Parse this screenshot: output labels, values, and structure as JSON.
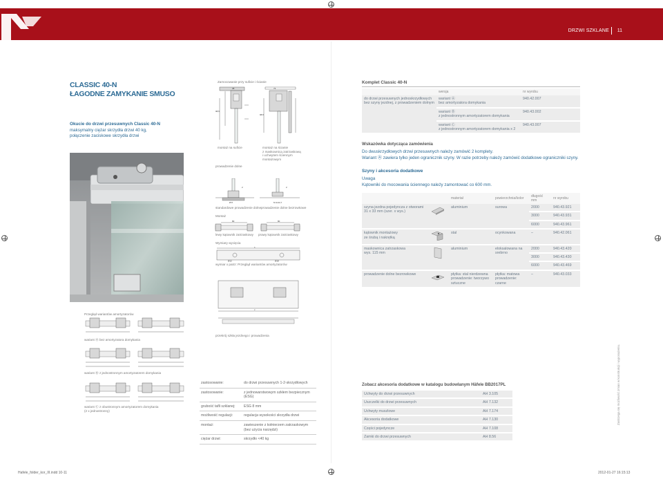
{
  "header": {
    "section_label": "DRZWI SZKLANE",
    "page_number": "11",
    "accent_color": "#a8101a"
  },
  "intro": {
    "title_line1": "CLASSIC 40-N",
    "title_line2": "ŁAGODNE ZAMYKANIE SMUSO",
    "subtitle": "Okucie do drzwi przesuwnych Classic 40-N",
    "desc_line1": "maksymalny ciężar skrzydła drzwi 40 kg,",
    "desc_line2": "połączenie zaciskowe skrzydła drzwi"
  },
  "drawings": {
    "mounting_title": "Zamocowanie przy suficie i ścianie",
    "ceiling_caption": "montaż na suficie",
    "wall_caption": "montaż na ścianie\nz maskownicą zatrzaskową\ni uchwytem ściennym\nmontażowym",
    "floor_guide_title": "prowadzenie dolne",
    "std_guide_caption": "standardowe prowadzenie dolne",
    "no_groove_caption": "prowadzenie dolne bezrowkowe",
    "assembly_title": "Montaż",
    "left_bracket_caption": "lewy kątownik zatrzaskowy",
    "right_bracket_caption": "prawy kątownik zatrzaskowy",
    "cut_title": "Wymiary wycięcia",
    "cut_caption": "wymiar x patrz: Przegląd wariantów amortyzatorów",
    "bottom_guide_caption": "przekrój szkła jezdnego i prowadzenia",
    "variants_title": "Przegląd wariantów amortyzatorów",
    "variant_a_caption": "wariant Ⓐ bez amortyzatora domykania",
    "variant_b_caption": "wariant Ⓑ z jednostronnym amortyzatorem domykania",
    "variant_c_caption": "wariant Ⓒ z obustronnym amortyzatorem domykania\n(2 x jednostronny)"
  },
  "specs": [
    {
      "label": "zastosowanie:",
      "value": "do drzwi przesuwnych 1-2-skrzydłowych"
    },
    {
      "label": "zastosowanie:",
      "value": "z jednowarstwowym szkłem bezpiecznym (ESG)"
    },
    {
      "label": "grubość tafli szklanej:",
      "value": "ESG 8 mm"
    },
    {
      "label": "możliwość regulacji:",
      "value": "regulacja wysokości skrzydła drzwi"
    },
    {
      "label": "montaż:",
      "value": "zawieszenie z kołnierzem zatrzaskowym\n(bez użycia narzędzi)"
    },
    {
      "label": "ciężar drzwi:",
      "value": "skrzydło <40 kg"
    }
  ],
  "kit": {
    "title": "Komplet Classic 40-N",
    "headers": [
      "wersja",
      "nr wyrobu"
    ],
    "desc": "do drzwi przesuwnych jednoskrzydłowych\nbez szyny jezdnej, z prowadzeniem dolnym",
    "rows": [
      {
        "variant": "wariant Ⓐ",
        "detail": "bez amortyzatora domykania",
        "number": "940.42.007"
      },
      {
        "variant": "wariant Ⓑ",
        "detail": "z jednostronnym amortyzatorem domykania",
        "number": "940.43.002"
      },
      {
        "variant": "wariant Ⓒ",
        "detail": "z jednostronnym amortyzatorem domykania x 2",
        "number": "940.43.007"
      }
    ]
  },
  "order_hint": {
    "title": "Wskazówka dotycząca zamówienia",
    "line1": "Do dwuskrzydłowych drzwi przesuwnych należy zamówić 2 komplety.",
    "line2": "Wariant Ⓐ zawiera tylko jeden ogranicznik szyny. W razie potrzeby należy zamówić dodatkowe ograniczniki szyny."
  },
  "rails": {
    "title": "Szyny i akcesoria dodatkowe",
    "note_title": "Uwaga",
    "note_text": "Kątowniki do mocowania ściennego należy zamontować co 600 mm.",
    "headers": [
      "materiał",
      "powierzchnia/kolor",
      "długość mm",
      "nr wyrobu"
    ],
    "rows": [
      {
        "name": "szyna jezdna pojedyncza z otworami\n31 x 33 mm (szer. x wys.)",
        "material": "aluminium",
        "finish": "surowa",
        "lengths": [
          "2000",
          "3000",
          "6000"
        ],
        "numbers": [
          "940.43.921",
          "940.43.931",
          "940.43.961"
        ]
      },
      {
        "name": "kątownik montażowy\nze śrubą i nakrętką",
        "material": "stal",
        "finish": "ocynkowana",
        "lengths": [
          "–"
        ],
        "numbers": [
          "940.42.061"
        ]
      },
      {
        "name": "maskownica zatrzaskowa\nwys. 115 mm",
        "material": "aluminium",
        "finish": "eloksalowana na\nsrebrno",
        "lengths": [
          "2000",
          "3000",
          "6000"
        ],
        "numbers": [
          "940.43.420",
          "940.43.430",
          "940.43.469"
        ]
      },
      {
        "name": "prowadzenie dolne bezrowkowe",
        "material": "płytka: stal nierdzewna\nprowadzenie: tworzywo\nsztuczne",
        "finish": "płytka: matowa\nprowadzenie:\nczarne",
        "lengths": [
          "–"
        ],
        "numbers": [
          "940.43.033"
        ]
      }
    ]
  },
  "catalog": {
    "title": "Zobacz akcesoria dodatkowe w katalogu budowlanym Häfele BB2017PL",
    "rows": [
      {
        "name": "Uchwyty do drzwi przesuwnych",
        "ref": "AH 3.105"
      },
      {
        "name": "Uszczelki do drzwi przesuwnych",
        "ref": "AH 7.132"
      },
      {
        "name": "Uchwyty muszlowe",
        "ref": "AH 7.174"
      },
      {
        "name": "Akcesoria dodatkowe",
        "ref": "AH 7.130"
      },
      {
        "name": "Części pojedyncze",
        "ref": "AH 7.108"
      },
      {
        "name": "Zamki do drzwi przesuwnych",
        "ref": "AH 8.56"
      }
    ]
  },
  "vertical_note": "Zastrzega się możliwość zmian w konstrukcji i wyposażeniu.",
  "footer": {
    "file_name": "Hafele_folder_kor_III.indd   10-11",
    "timestamp": "2012-01-27   16:15:13"
  }
}
